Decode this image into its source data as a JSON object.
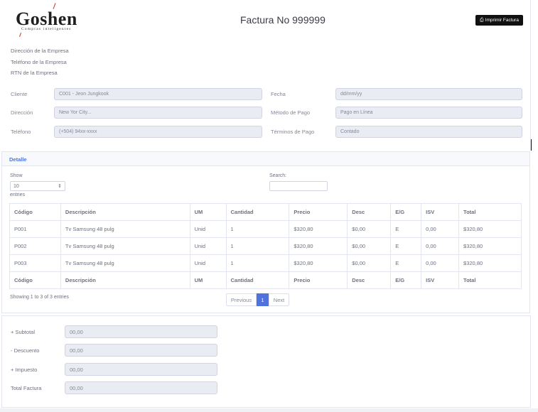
{
  "brand": {
    "name": "Goshen",
    "tagline": "Compras inteligentes"
  },
  "header": {
    "title": "Factura No 999999",
    "print_label": "Imprimir Factura",
    "print_icon": "print-icon"
  },
  "company": {
    "address": "Dirección de la Empresa",
    "phone": "Teléfono de la Empresa",
    "rtn": "RTN de la Empresa"
  },
  "form": {
    "cliente_label": "Cliente",
    "cliente_value": "C001 - Jeon Jungkook",
    "direccion_label": "Dirección",
    "direccion_value": "New Yor City...",
    "telefono_label": "Teléfono",
    "telefono_value": "(+504) 94xx-xxxx",
    "fecha_label": "Fecha",
    "fecha_value": "dd/mm/yy",
    "metodo_label": "Método de Pago",
    "metodo_value": "Pago en Línea",
    "terminos_label": "Términos de Pago",
    "terminos_value": "Contado"
  },
  "detail": {
    "title": "Detalle",
    "show_label": "Show",
    "page_size": "10",
    "entries_label": "entries",
    "search_label": "Search:",
    "columns": [
      "Código",
      "Descripción",
      "UM",
      "Cantidad",
      "Precio",
      "Desc",
      "E/G",
      "ISV",
      "Total"
    ],
    "rows": [
      [
        "P001",
        "Tv Samsung 48 pulg",
        "Unid",
        "1",
        "$320,80",
        "$0,00",
        "E",
        "0,00",
        "$320,80"
      ],
      [
        "P002",
        "Tv Samsung 48 pulg",
        "Unid",
        "1",
        "$320,80",
        "$0,00",
        "E",
        "0,00",
        "$320,80"
      ],
      [
        "P003",
        "Tv Samsung 48 pulg",
        "Unid",
        "1",
        "$320,80",
        "$0,00",
        "E",
        "0,00",
        "$320,80"
      ]
    ],
    "showing": "Showing 1 to 3 of 3 entries",
    "pager": {
      "previous": "Previous",
      "current": "1",
      "next": "Next"
    }
  },
  "totals": {
    "subtotal_label": "+ Subtotal",
    "subtotal_value": "00,00",
    "descuento_label": "- Descuento",
    "descuento_value": "00,00",
    "impuesto_label": "+ Impuesto",
    "impuesto_value": "00,00",
    "total_label": "Total Factura",
    "total_value": "00,00"
  },
  "colors": {
    "accent": "#4e73df",
    "input_bg": "#eaecf4",
    "print_button": "#111111"
  }
}
